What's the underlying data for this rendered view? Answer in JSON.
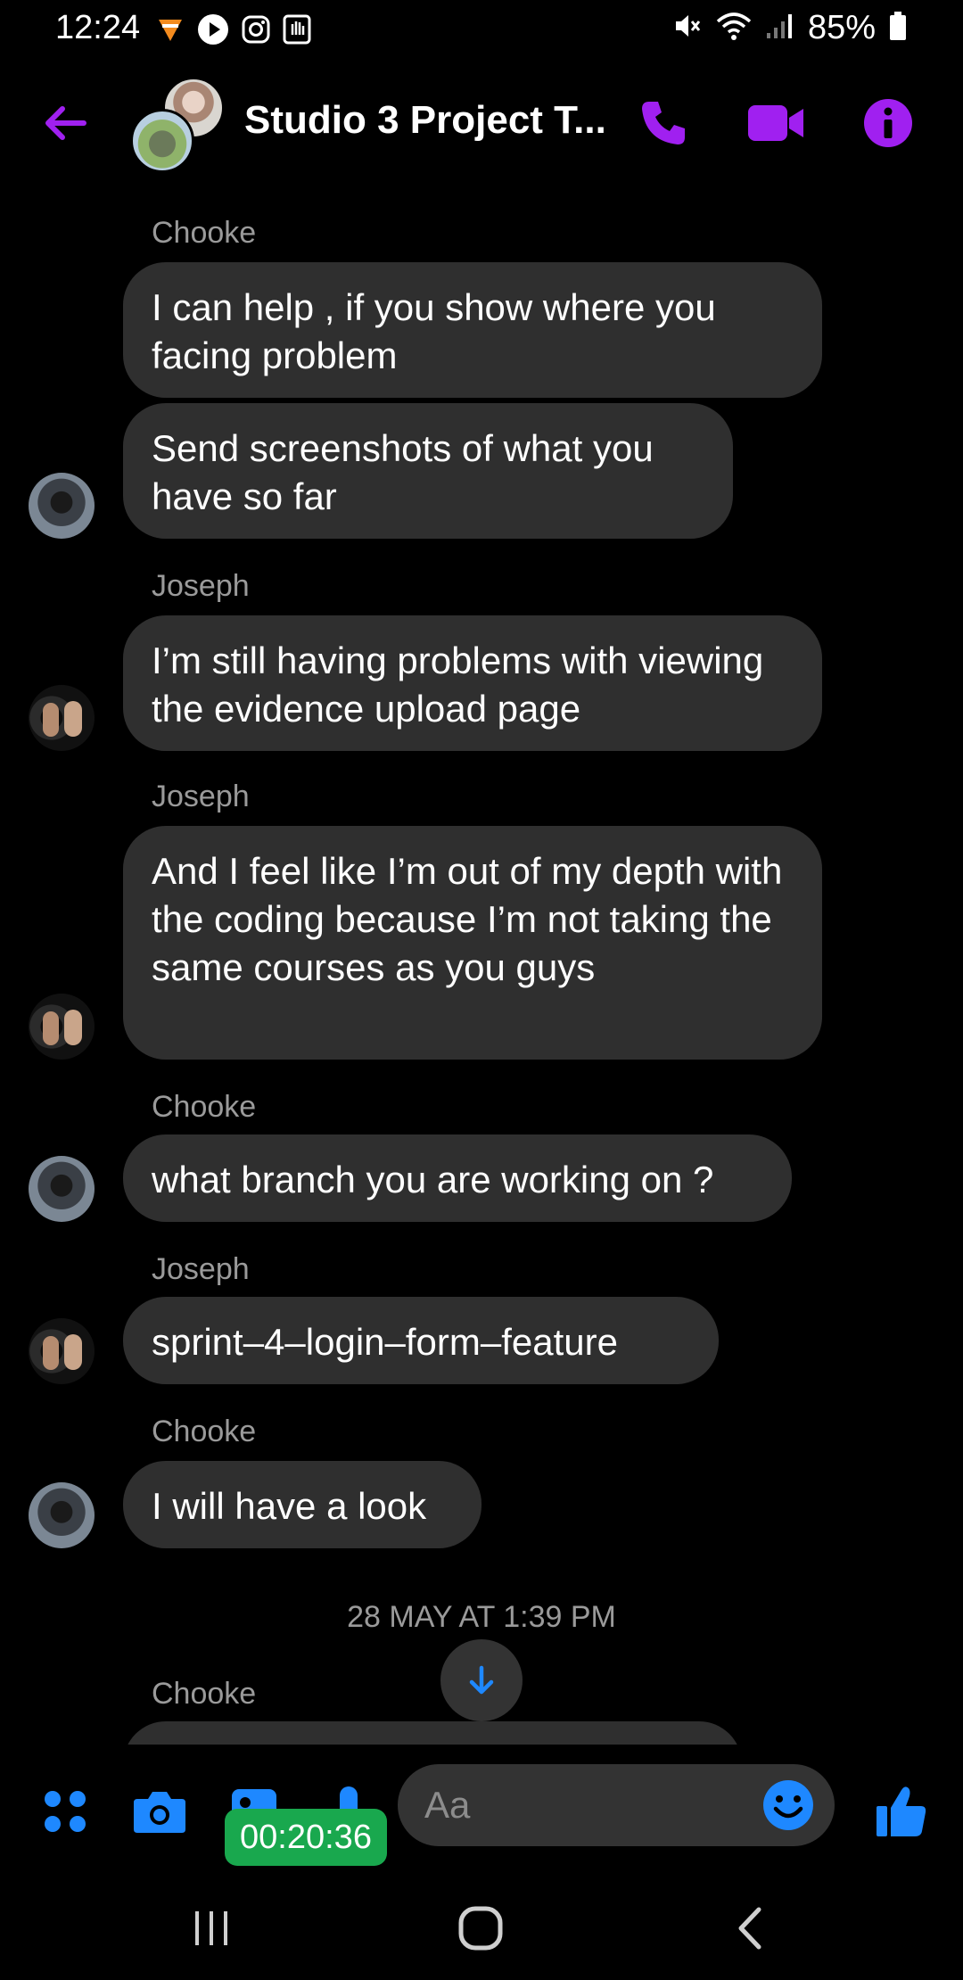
{
  "status_bar": {
    "time": "12:24",
    "battery": "85%",
    "left_icons": [
      "vlc-icon",
      "play-icon",
      "instagram-icon",
      "hand-icon"
    ],
    "right_icons": [
      "mute-icon",
      "wifi-icon",
      "signal-icon",
      "battery-icon"
    ]
  },
  "header": {
    "title": "Studio 3 Project T...",
    "accent_color": "#a020f0"
  },
  "messages": [
    {
      "sender": "Chooke",
      "bubbles": [
        "I can help , if you show where you facing problem",
        "Send screenshots of what you have so far"
      ]
    },
    {
      "sender": "Joseph",
      "bubbles": [
        "I’m still having problems with viewing the evidence upload page"
      ]
    },
    {
      "sender": "Joseph",
      "bubbles": [
        "And I feel like I’m out of my depth with the coding because I’m not taking the same courses as you guys"
      ]
    },
    {
      "sender": "Chooke",
      "bubbles": [
        "what branch you are working on ?"
      ]
    },
    {
      "sender": "Joseph",
      "bubbles": [
        "sprint–4–login–form–feature"
      ]
    },
    {
      "sender": "Chooke",
      "bubbles": [
        "I will have a look"
      ]
    }
  ],
  "date_separator": "28 MAY AT 1:39 PM",
  "next_sender": "Chooke",
  "composer": {
    "placeholder": "Aa",
    "accent_color": "#1e88ff"
  },
  "recording_timer": "00:20:36"
}
